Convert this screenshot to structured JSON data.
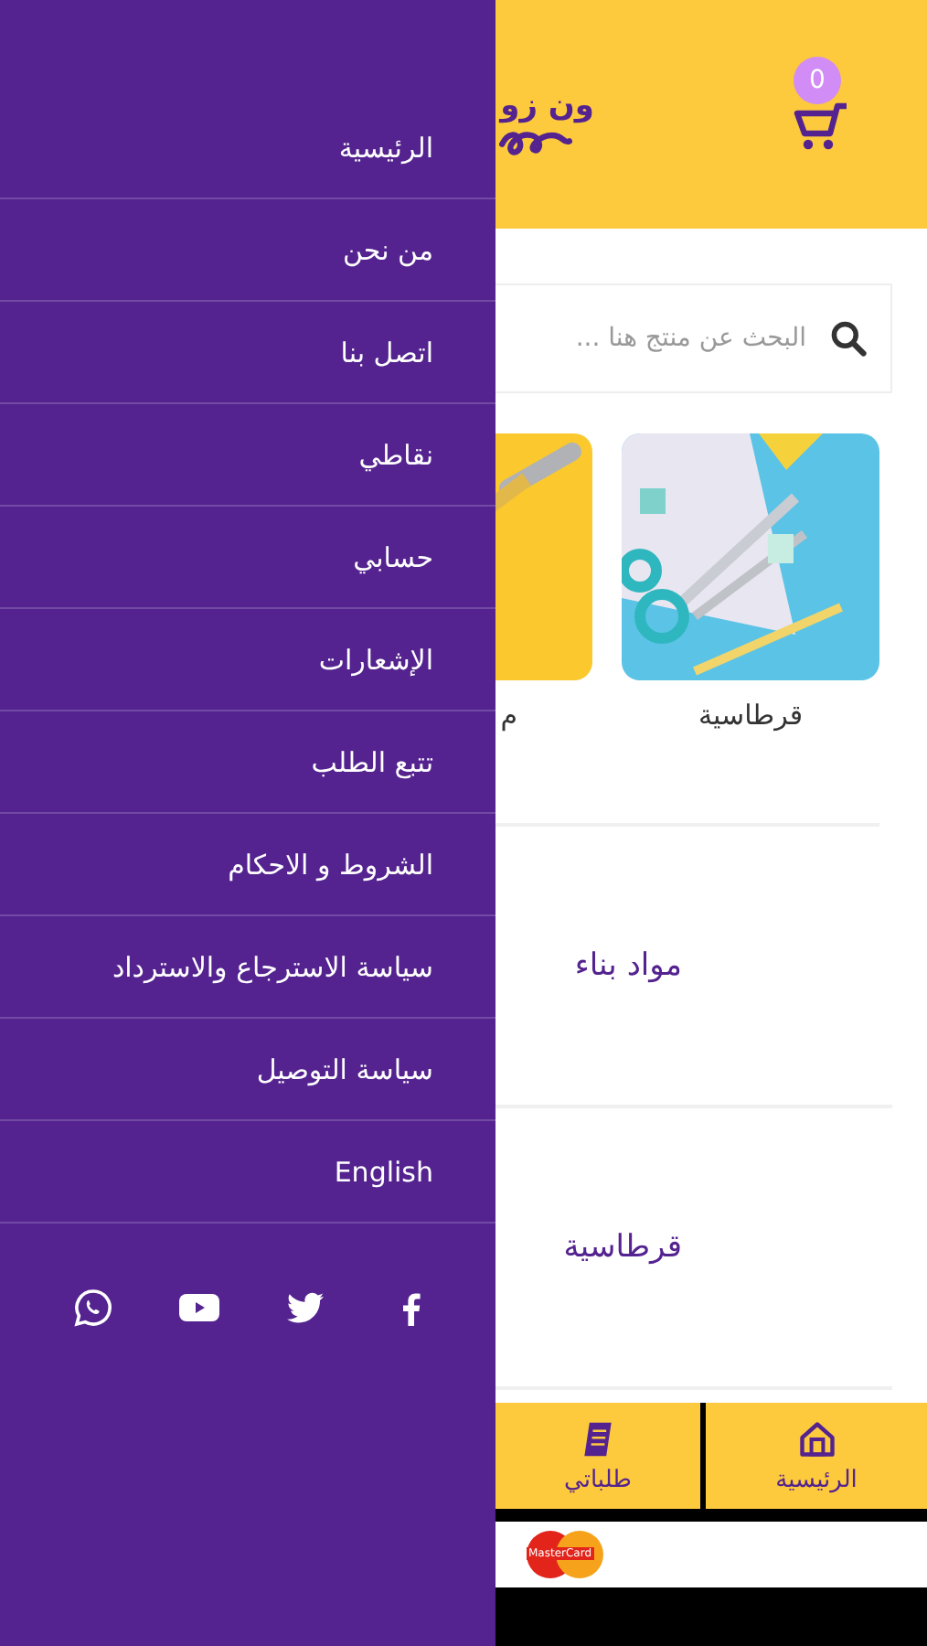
{
  "drawer": {
    "menu": [
      {
        "label": "الرئيسية"
      },
      {
        "label": "من نحن"
      },
      {
        "label": "اتصل بنا"
      },
      {
        "label": "نقاطي"
      },
      {
        "label": "حسابي"
      },
      {
        "label": "الإشعارات"
      },
      {
        "label": "تتبع الطلب"
      },
      {
        "label": "الشروط و الاحكام"
      },
      {
        "label": "سياسة الاسترجاع والاسترداد"
      },
      {
        "label": "سياسة التوصيل"
      },
      {
        "label": "English"
      }
    ],
    "social": [
      {
        "kind": "facebook"
      },
      {
        "kind": "twitter"
      },
      {
        "kind": "youtube"
      },
      {
        "kind": "whatsapp"
      }
    ]
  },
  "header": {
    "logo_text": "ون زو",
    "cart_count": "0"
  },
  "search": {
    "placeholder": "البحث عن منتج هنا ..."
  },
  "category_cards": [
    {
      "label": "قرطاسية"
    },
    {
      "label": "م"
    }
  ],
  "sections": [
    {
      "title": "مواد بناء"
    },
    {
      "title": "قرطاسية"
    }
  ],
  "bottom_nav": [
    {
      "label": "الرئيسية"
    },
    {
      "label": "طلباتي"
    }
  ],
  "payment_logo": "MasterCard"
}
